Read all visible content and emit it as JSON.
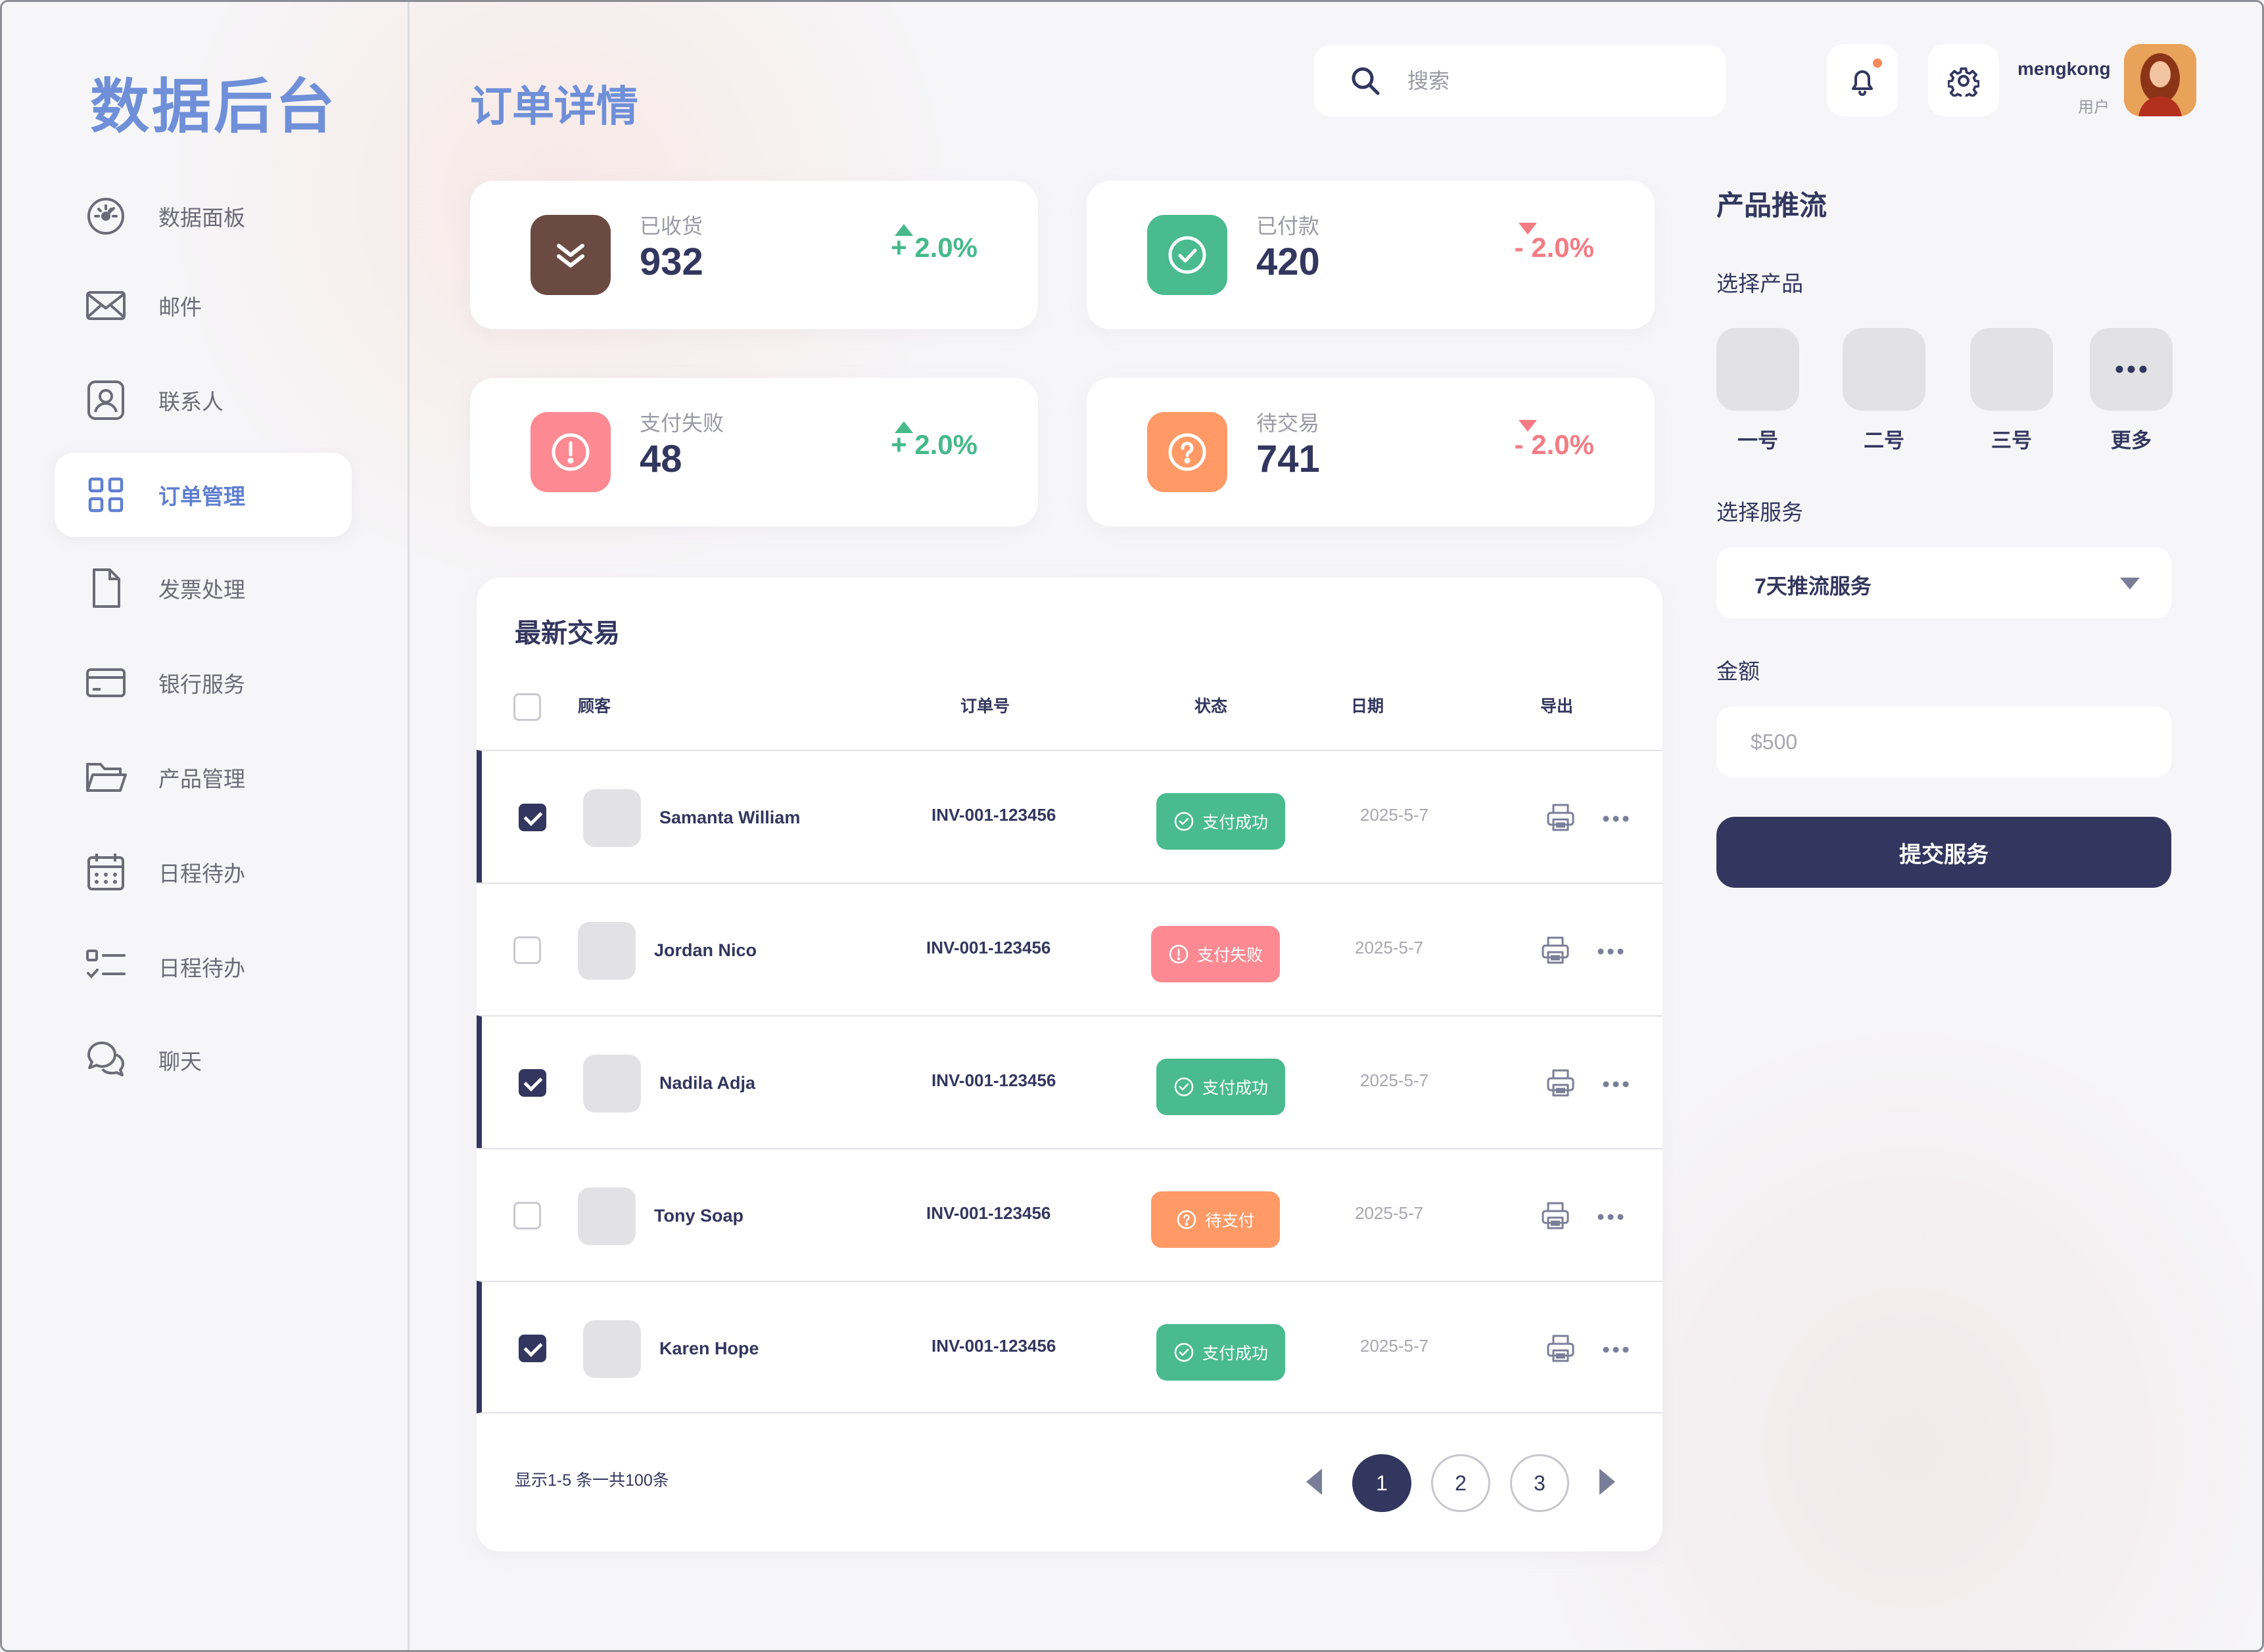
{
  "app": {
    "brand": "数据后台"
  },
  "sidebar": {
    "items": [
      {
        "label": "数据面板",
        "icon": "dashboard-icon",
        "active": false
      },
      {
        "label": "邮件",
        "icon": "mail-icon",
        "active": false
      },
      {
        "label": "联系人",
        "icon": "contact-icon",
        "active": false
      },
      {
        "label": "订单管理",
        "icon": "grid-icon",
        "active": true
      },
      {
        "label": "发票处理",
        "icon": "document-icon",
        "active": false
      },
      {
        "label": "银行服务",
        "icon": "card-icon",
        "active": false
      },
      {
        "label": "产品管理",
        "icon": "folder-icon",
        "active": false
      },
      {
        "label": "日程待办",
        "icon": "calendar-icon",
        "active": false
      },
      {
        "label": "日程待办",
        "icon": "checklist-icon",
        "active": false
      },
      {
        "label": "聊天",
        "icon": "chat-icon",
        "active": false
      }
    ]
  },
  "header": {
    "title": "订单详情",
    "search_placeholder": "搜索",
    "user": {
      "name": "mengkong",
      "role": "用户"
    }
  },
  "stats": [
    {
      "label": "已收货",
      "value": "932",
      "trend": "+ 2.0%",
      "direction": "up",
      "icon": "double-check-icon",
      "color": "#6b4a42"
    },
    {
      "label": "已付款",
      "value": "420",
      "trend": "- 2.0%",
      "direction": "down",
      "icon": "check-circle-icon",
      "color": "#49bb8e"
    },
    {
      "label": "支付失败",
      "value": "48",
      "trend": "+ 2.0%",
      "direction": "up",
      "icon": "alert-circle-icon",
      "color": "#fd8a92"
    },
    {
      "label": "待交易",
      "value": "741",
      "trend": "- 2.0%",
      "direction": "down",
      "icon": "question-circle-icon",
      "color": "#ff9a66"
    }
  ],
  "transactions": {
    "title": "最新交易",
    "columns": [
      "顾客",
      "订单号",
      "状态",
      "日期",
      "导出"
    ],
    "rows": [
      {
        "customer": "Samanta William",
        "order": "INV-001-123456",
        "status": "支付成功",
        "status_type": "success",
        "date": "2025-5-7",
        "checked": true
      },
      {
        "customer": "Jordan Nico",
        "order": "INV-001-123456",
        "status": "支付失败",
        "status_type": "fail",
        "date": "2025-5-7",
        "checked": false
      },
      {
        "customer": "Nadila Adja",
        "order": "INV-001-123456",
        "status": "支付成功",
        "status_type": "success",
        "date": "2025-5-7",
        "checked": true
      },
      {
        "customer": "Tony Soap",
        "order": "INV-001-123456",
        "status": "待支付",
        "status_type": "pending",
        "date": "2025-5-7",
        "checked": false
      },
      {
        "customer": "Karen Hope",
        "order": "INV-001-123456",
        "status": "支付成功",
        "status_type": "success",
        "date": "2025-5-7",
        "checked": true
      }
    ],
    "footer": "显示1-5 条一共100条",
    "pages": [
      "1",
      "2",
      "3"
    ],
    "current_page": "1"
  },
  "promo": {
    "title": "产品推流",
    "select_product_label": "选择产品",
    "products": [
      "一号",
      "二号",
      "三号",
      "更多"
    ],
    "select_service_label": "选择服务",
    "service_value": "7天推流服务",
    "amount_label": "金额",
    "amount_placeholder": "$500",
    "submit_label": "提交服务"
  }
}
